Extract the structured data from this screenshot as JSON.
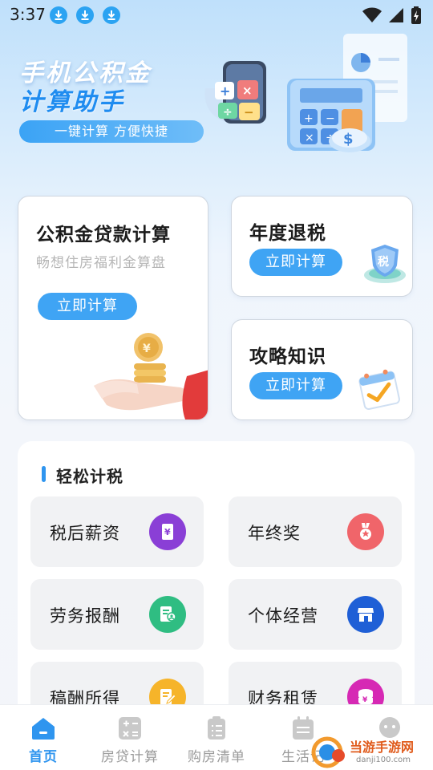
{
  "status_bar": {
    "time": "3:37"
  },
  "banner": {
    "title_line1": "手机公积金",
    "title_line2": "计算助手",
    "tagline": "一键计算 方便快捷"
  },
  "cards": {
    "loan": {
      "title": "公积金贷款计算",
      "subtitle": "畅想住房福利金算盘",
      "button": "立即计算"
    },
    "tax_refund": {
      "title": "年度退税",
      "button": "立即计算"
    },
    "guide": {
      "title": "攻略知识",
      "button": "立即计算"
    }
  },
  "easy_tax": {
    "title": "轻松计税",
    "items": [
      {
        "label": "税后薪资",
        "icon": "salary-icon",
        "color": "#8a3fd6"
      },
      {
        "label": "年终奖",
        "icon": "medal-icon",
        "color": "#f0656a"
      },
      {
        "label": "劳务报酬",
        "icon": "document-user-icon",
        "color": "#2fbd82"
      },
      {
        "label": "个体经营",
        "icon": "shop-icon",
        "color": "#1f5fd6"
      },
      {
        "label": "稿酬所得",
        "icon": "pen-document-icon",
        "color": "#f6b42a"
      },
      {
        "label": "财务租赁",
        "icon": "coin-icon",
        "color": "#d629b4"
      }
    ]
  },
  "bottom_nav": {
    "items": [
      {
        "label": "首页",
        "icon": "home-icon",
        "active": true
      },
      {
        "label": "房贷计算",
        "icon": "calculator-icon",
        "active": false
      },
      {
        "label": "购房清单",
        "icon": "checklist-icon",
        "active": false
      },
      {
        "label": "生活记",
        "icon": "calendar-icon",
        "active": false
      },
      {
        "label": "",
        "icon": "chat-icon",
        "active": false
      }
    ]
  },
  "watermark": {
    "text": "当游手游网",
    "url": "danji100.com"
  },
  "colors": {
    "accent": "#3fa4f4",
    "nav_active": "#2f95ef"
  }
}
